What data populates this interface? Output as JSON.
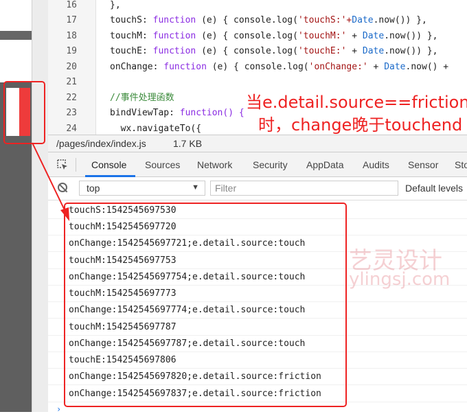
{
  "editor": {
    "lines": [
      {
        "num": "16",
        "text": "},"
      },
      {
        "num": "17",
        "prop": "touchS",
        "str": "'touchS:'+",
        "concat": ""
      },
      {
        "num": "18",
        "prop": "touchM",
        "str": "'touchM:'",
        "concat": " + "
      },
      {
        "num": "19",
        "prop": "touchE",
        "str": "'touchE:'",
        "concat": " + "
      },
      {
        "num": "20",
        "prop": "onChange",
        "str": "'onChange:'",
        "concat": " + "
      },
      {
        "num": "21",
        "text": ""
      },
      {
        "num": "22",
        "comment": "//事件处理函数"
      },
      {
        "num": "23",
        "prop": "bindViewTap",
        "rest": "function() {"
      },
      {
        "num": "24",
        "text": "  wx.navigateTo({"
      }
    ],
    "kw_function": "function",
    "param_e": " (e) { console.log(",
    "date_now": "Date",
    "now_call": ".now()",
    "close_17": ") },",
    "close_rest": ") },",
    "tail_20": " +"
  },
  "annotation": {
    "line1": "当e.detail.source==friction",
    "line2": "时，change晚于touchend"
  },
  "file_bar": {
    "path": "/pages/index/index.js",
    "size": "1.7 KB"
  },
  "devtools_tabs": [
    "Console",
    "Sources",
    "Network",
    "Security",
    "AppData",
    "Audits",
    "Sensor",
    "Sto"
  ],
  "console_toolbar": {
    "context": "top",
    "filter_placeholder": "Filter",
    "levels": "Default levels"
  },
  "console_logs": [
    "touchS:1542545697530",
    "touchM:1542545697720",
    "onChange:1542545697721;e.detail.source:touch",
    "touchM:1542545697753",
    "onChange:1542545697754;e.detail.source:touch",
    "touchM:1542545697773",
    "onChange:1542545697774;e.detail.source:touch",
    "touchM:1542545697787",
    "onChange:1542545697787;e.detail.source:touch",
    "touchE:1542545697806",
    "onChange:1542545697820;e.detail.source:friction",
    "onChange:1542545697837;e.detail.source:friction"
  ],
  "console_prompt": "›",
  "watermark": {
    "line1": "艺灵设计",
    "line2": "ylingsj.com"
  },
  "colors": {
    "highlight": "#ee2222",
    "active_tab": "#1a73e8",
    "keyword": "#8a2be2",
    "string": "#a31515",
    "function_name": "#1b6ac9",
    "comment": "#3a8a3a"
  }
}
